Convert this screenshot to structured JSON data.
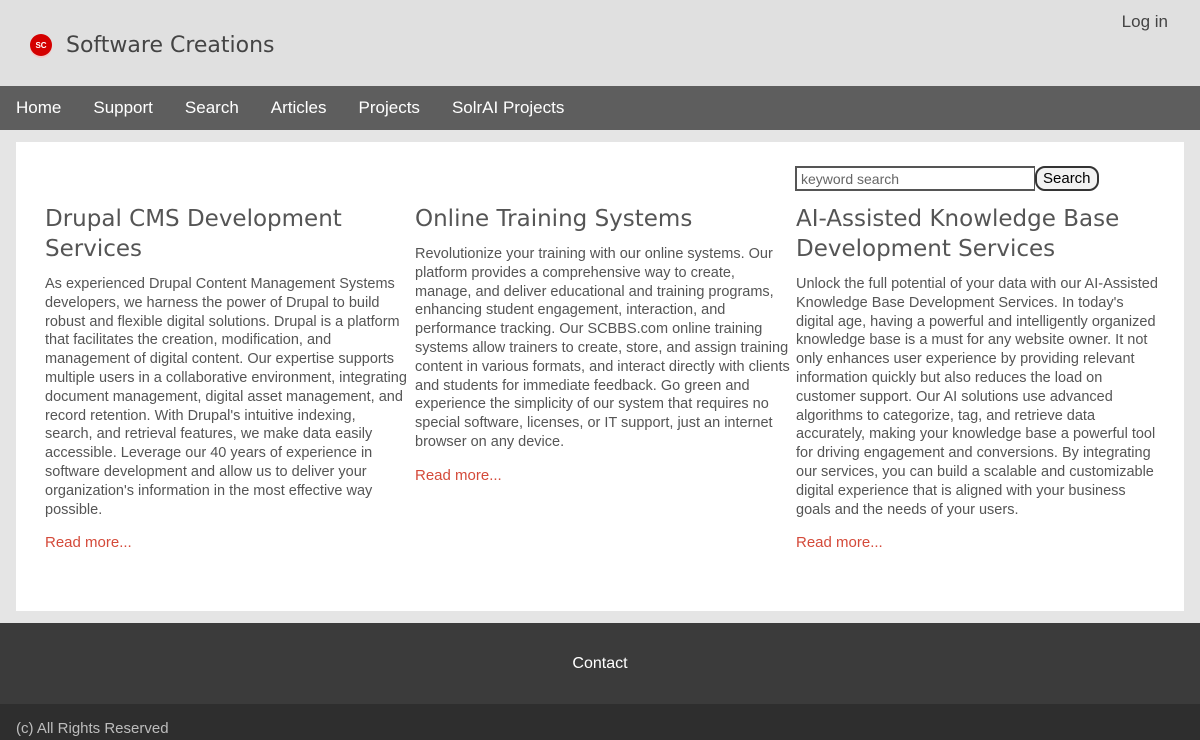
{
  "header": {
    "logo_text": "SC",
    "site_name": "Software Creations",
    "login_label": "Log in"
  },
  "nav": {
    "items": [
      "Home",
      "Support",
      "Search",
      "Articles",
      "Projects",
      "SolrAI Projects"
    ]
  },
  "search": {
    "placeholder": "keyword search",
    "button_label": "Search"
  },
  "columns": [
    {
      "title": "Drupal CMS Development Services",
      "body": "As experienced Drupal Content Management Systems developers, we harness the power of Drupal to build robust and flexible digital solutions. Drupal is a platform that facilitates the creation, modification, and management of digital content. Our expertise supports multiple users in a collaborative environment, integrating document management, digital asset management, and record retention. With Drupal's intuitive indexing, search, and retrieval features, we make data easily accessible. Leverage our 40 years of experience in software development and allow us to deliver your organization's information in the most effective way possible.",
      "read_more": "Read more..."
    },
    {
      "title": "Online Training Systems",
      "body": "Revolutionize your training with our online systems. Our platform provides a comprehensive way to create, manage, and deliver educational and training programs, enhancing student engagement, interaction, and performance tracking. Our SCBBS.com online training systems allow trainers to create, store, and assign training content in various formats, and interact directly with clients and students for immediate feedback. Go green and experience the simplicity of our system that requires no special software, licenses, or IT support, just an internet browser on any device.",
      "read_more": "Read more..."
    },
    {
      "title": "AI-Assisted Knowledge Base Development Services",
      "body": "Unlock the full potential of your data with our AI-Assisted Knowledge Base Development Services. In today's digital age, having a powerful and intelligently organized knowledge base is a must for any website owner. It not only enhances user experience by providing relevant information quickly but also reduces the load on customer support. Our AI solutions use advanced algorithms to categorize, tag, and retrieve data accurately, making your knowledge base a powerful tool for driving engagement and conversions. By integrating our services, you can build a scalable and customizable digital experience that is aligned with your business goals and the needs of your users.",
      "read_more": "Read more..."
    }
  ],
  "footer": {
    "contact_label": "Contact",
    "copyright": "(c) All Rights Reserved"
  },
  "colors": {
    "header_bg": "#e0e0e0",
    "nav_bg": "#5e5e5e",
    "footer_bg": "#3b3b3b",
    "bottom_bg": "#2e2e2e",
    "logo_red": "#d40000",
    "link_red": "#d44a3a"
  }
}
